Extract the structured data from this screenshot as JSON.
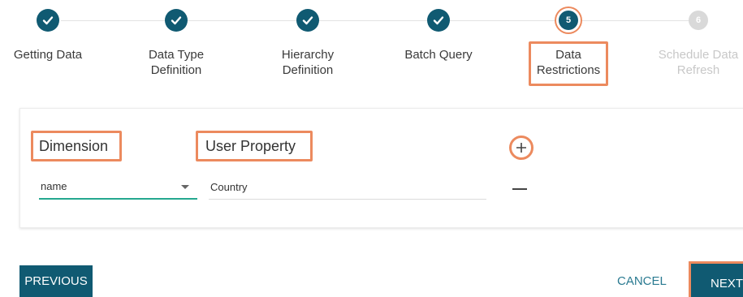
{
  "stepper": {
    "steps": [
      {
        "number": "1",
        "label": "Getting Data",
        "status": "done"
      },
      {
        "number": "2",
        "label": "Data Type\nDefinition",
        "status": "done"
      },
      {
        "number": "3",
        "label": "Hierarchy\nDefinition",
        "status": "done"
      },
      {
        "number": "4",
        "label": "Batch Query",
        "status": "done"
      },
      {
        "number": "5",
        "label": "Data\nRestrictions",
        "status": "active"
      },
      {
        "number": "6",
        "label": "Schedule Data\nRefresh",
        "status": "pending"
      }
    ]
  },
  "restrictions": {
    "dimension_header": "Dimension",
    "user_property_header": "User Property",
    "rows": [
      {
        "dimension": "name",
        "user_property": "Country"
      }
    ]
  },
  "footer": {
    "previous_label": "PREVIOUS",
    "cancel_label": "CANCEL",
    "next_label": "NEXT"
  },
  "colors": {
    "primary": "#105a72",
    "highlight": "#ec8a5e",
    "accent_underline": "#24a88f",
    "pending": "#d9d9d9"
  },
  "icons": {
    "done": "check-icon",
    "add": "plus-icon",
    "remove": "minus-icon",
    "dropdown": "caret-down-icon"
  }
}
